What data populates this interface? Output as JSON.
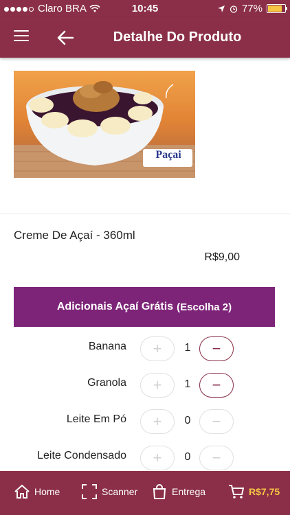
{
  "status": {
    "carrier": "Claro BRA",
    "time": "10:45",
    "battery": "77%"
  },
  "header": {
    "title": "Detalhe Do Produto"
  },
  "product": {
    "name": "Creme De Açaí - 360ml",
    "price": "R$9,00",
    "image_brand": "Paçai"
  },
  "addons": {
    "title": "Adicionais Açaí Grátis",
    "subtitle": "(Escolha 2)",
    "items": [
      {
        "label": "Banana",
        "qty": "1"
      },
      {
        "label": "Granola",
        "qty": "1"
      },
      {
        "label": "Leite Em Pó",
        "qty": "0"
      },
      {
        "label": "Leite Condensado",
        "qty": "0"
      }
    ]
  },
  "tabbar": {
    "home": "Home",
    "scanner": "Scanner",
    "delivery": "Entrega",
    "cart_total": "R$7,75"
  },
  "colors": {
    "brand": "#8a2f47",
    "section": "#7d2478",
    "accent": "#f7c744"
  }
}
